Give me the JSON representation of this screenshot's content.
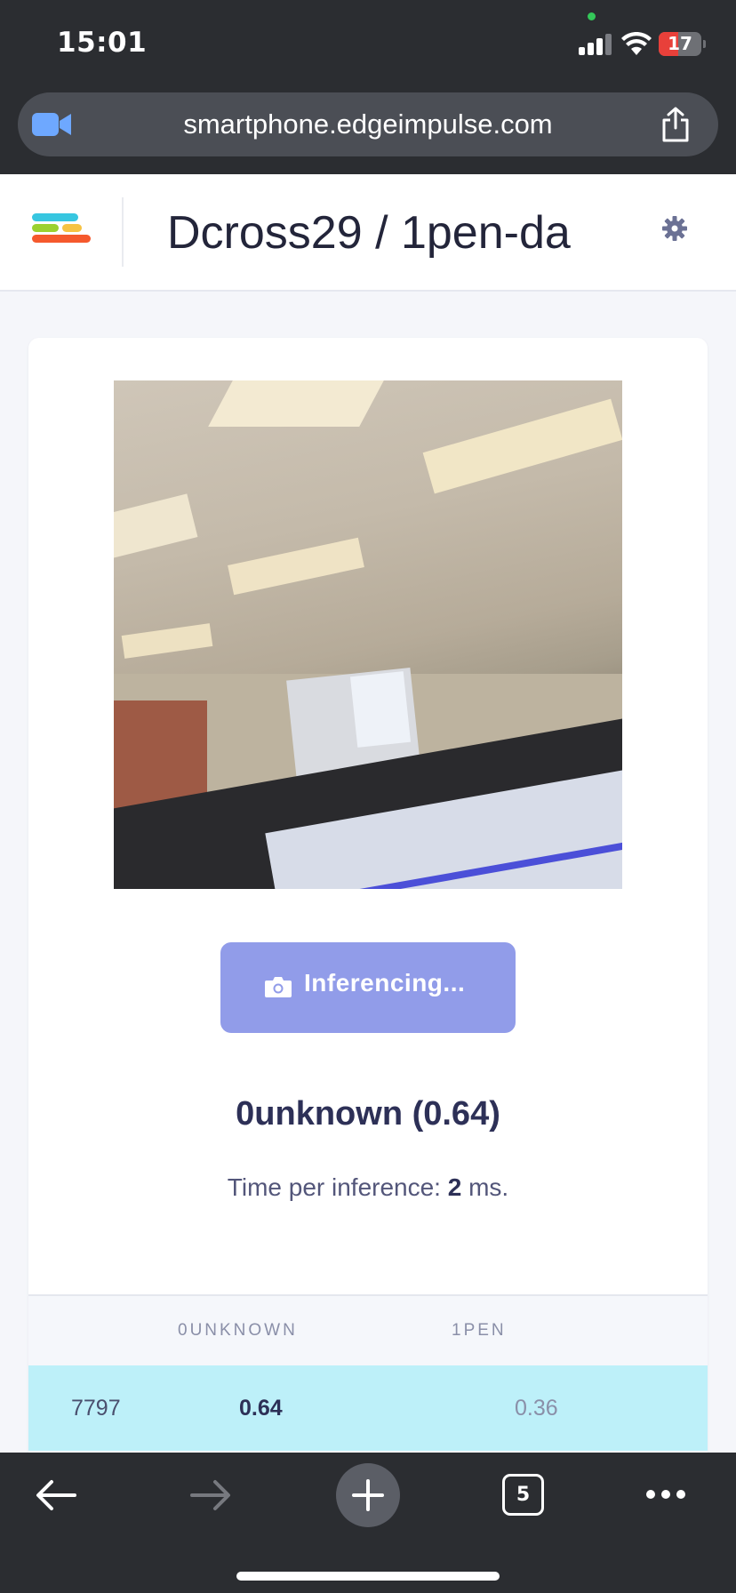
{
  "status_bar": {
    "time": "15:01",
    "battery_level": "17"
  },
  "browser": {
    "url": "smartphone.edgeimpulse.com",
    "tab_count": "5"
  },
  "header": {
    "project_title": "Dcross29 / 1pen-da"
  },
  "classifier": {
    "button_label": "Inferencing...",
    "result_label": "0unknown (0.64)",
    "timing_prefix": "Time per inference: ",
    "timing_value": "2",
    "timing_suffix": " ms."
  },
  "results_table": {
    "headers": [
      "",
      "0UNKNOWN",
      "1PEN"
    ],
    "rows": [
      {
        "id": "7797",
        "unknown": "0.64",
        "pen": "0.36"
      }
    ]
  },
  "colors": {
    "status_bar_bg": "#2b2d31",
    "button_bg": "#919ce9",
    "row_highlight": "#bdf0f9",
    "battery_low": "#e8403a"
  },
  "icons": {
    "facetime": "camera-icon",
    "share": "share-icon",
    "settings": "gear-icon",
    "camera": "camera-icon",
    "back": "arrow-left-icon",
    "forward": "arrow-right-icon",
    "new_tab": "plus-icon",
    "tabs": "tabs-icon",
    "more": "more-icon"
  }
}
